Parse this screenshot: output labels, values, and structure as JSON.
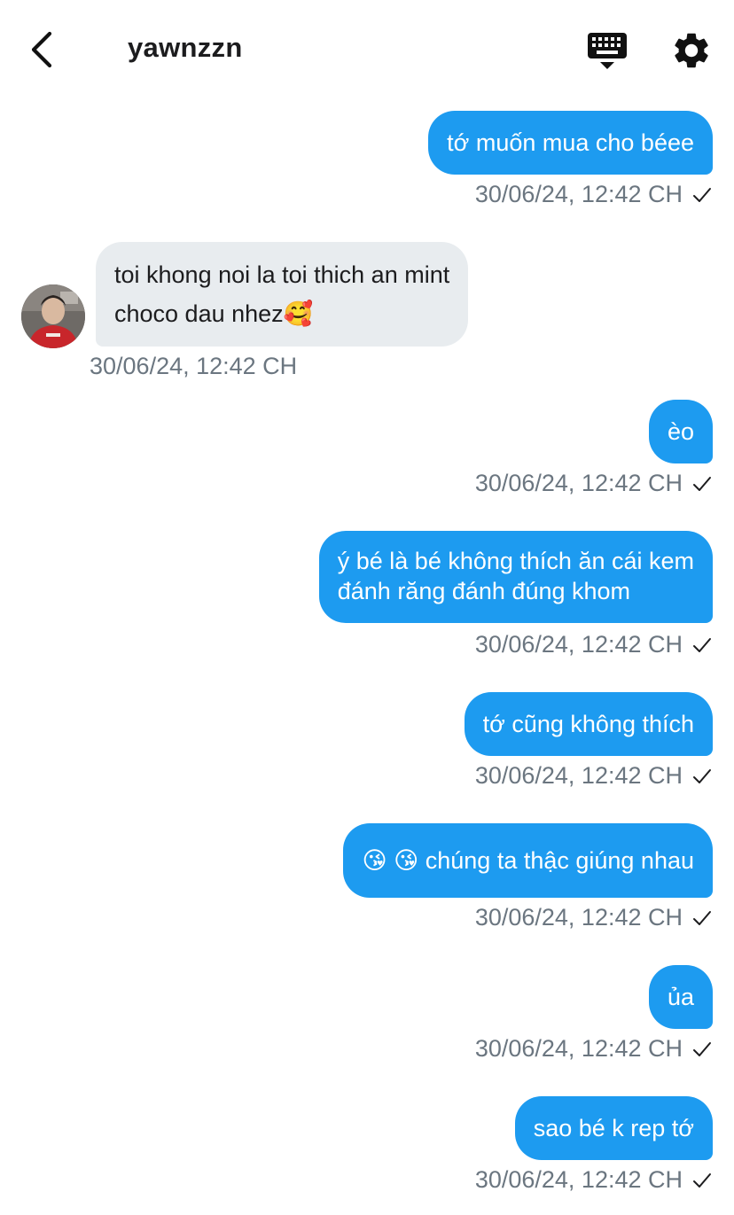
{
  "header": {
    "title": "yawnzzn",
    "back_icon": "chevron-left-icon",
    "keyboard_icon": "keyboard-icon",
    "settings_icon": "gear-icon"
  },
  "colors": {
    "outgoing_bubble": "#1d9bf0",
    "incoming_bubble": "#e8ecef",
    "timestamp": "#6b7680"
  },
  "messages": [
    {
      "sender": "me",
      "text": "tớ muốn mua cho béee",
      "time": "30/06/24, 12:42 CH",
      "status": "sent"
    },
    {
      "sender": "them",
      "line1": "toi khong noi la toi thich an mint",
      "line2": "choco dau nhez🥰",
      "time": "30/06/24, 12:42 CH"
    },
    {
      "sender": "me",
      "text": "èo",
      "time": "30/06/24, 12:42 CH",
      "status": "sent"
    },
    {
      "sender": "me",
      "line1": "ý bé là bé không thích ăn cái kem",
      "line2": "đánh răng đánh đúng khom",
      "time": "30/06/24, 12:42 CH",
      "status": "sent"
    },
    {
      "sender": "me",
      "text": "tớ cũng không thích",
      "time": "30/06/24, 12:42 CH",
      "status": "sent"
    },
    {
      "sender": "me",
      "text": "😘 😘 chúng ta thậc giúng nhau",
      "time": "30/06/24, 12:42 CH",
      "status": "sent"
    },
    {
      "sender": "me",
      "text": "ủa",
      "time": "30/06/24, 12:42 CH",
      "status": "sent"
    },
    {
      "sender": "me",
      "text": "sao bé k rep tớ",
      "time": "30/06/24, 12:42 CH",
      "status": "sent"
    }
  ]
}
